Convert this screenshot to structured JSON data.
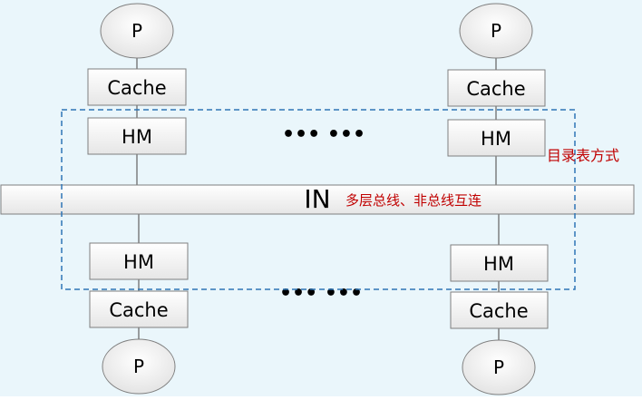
{
  "top_nodes": {
    "left": {
      "processor": "P",
      "cache": "Cache",
      "hm": "HM"
    },
    "right": {
      "processor": "P",
      "cache": "Cache",
      "hm": "HM"
    }
  },
  "bottom_nodes": {
    "left": {
      "processor": "P",
      "cache": "Cache",
      "hm": "HM"
    },
    "right": {
      "processor": "P",
      "cache": "Cache",
      "hm": "HM"
    }
  },
  "interconnect": {
    "label": "IN",
    "description": "多层总线、非总线互连"
  },
  "ellipsis_top": "••• •••",
  "ellipsis_bottom": "••• •••",
  "directory_label": "目录表方式",
  "colors": {
    "background": "#eaf6fb",
    "box_fill": "#f4f4f4",
    "box_stroke": "#7f7f7f",
    "dashed_region": "#2e75b6",
    "annotation_red": "#c00000"
  }
}
